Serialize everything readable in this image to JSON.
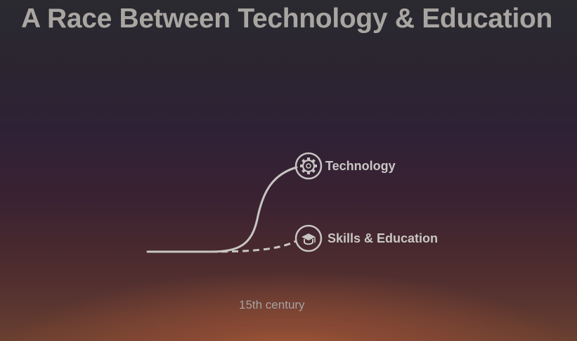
{
  "slide": {
    "title": "A Race Between Technology & Education",
    "caption": "15th century"
  },
  "series": {
    "technology": {
      "label": "Technology",
      "icon": "gear-icon",
      "line_style": "solid"
    },
    "skills": {
      "label": "Skills & Education",
      "icon": "graduation-cap-icon",
      "line_style": "dashed"
    }
  },
  "colors": {
    "line": "#c8c5c3",
    "title": "#a9a6a2",
    "label": "#c9c6c4",
    "background_top": "#2a2a30",
    "background_bottom": "#6a4030"
  }
}
